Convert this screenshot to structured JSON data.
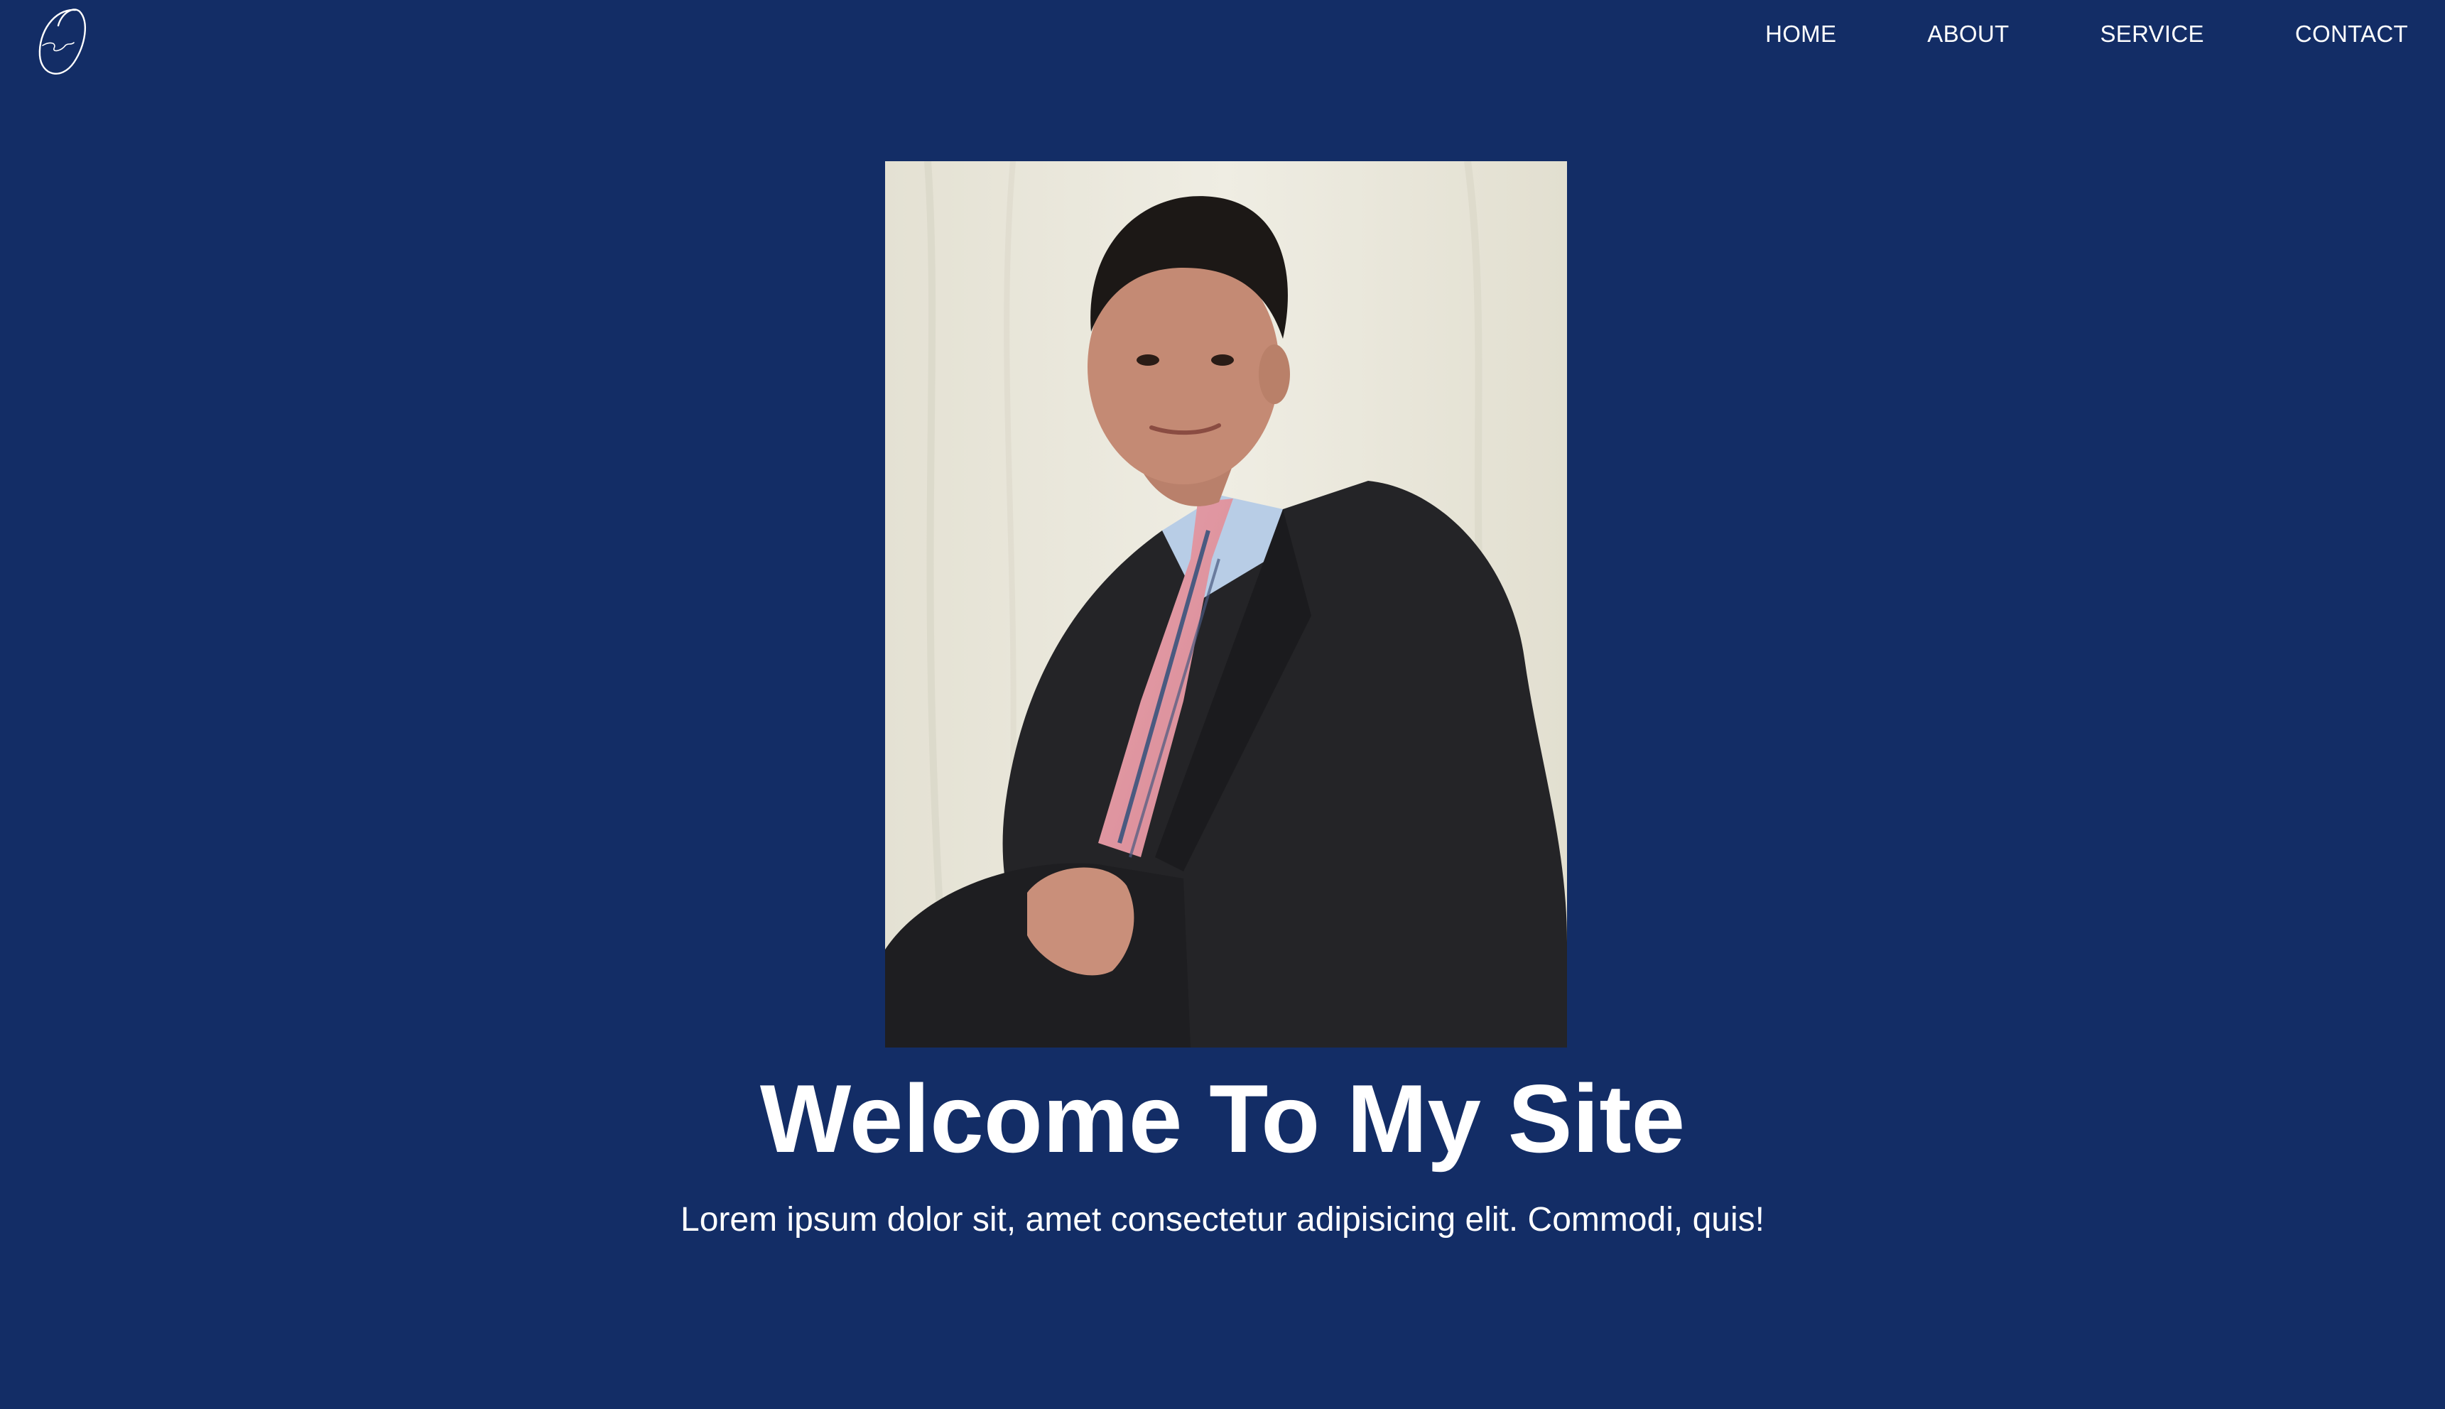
{
  "header": {
    "logo_icon": "signature-logo-icon",
    "nav": {
      "home": "HOME",
      "about": "ABOUT",
      "service": "SERVICE",
      "contact": "CONTACT"
    }
  },
  "hero": {
    "photo_icon": "portrait-photo",
    "title": "Welcome To My Site",
    "subtitle": "Lorem ipsum dolor sit, amet consectetur adipisicing elit. Commodi, quis!"
  },
  "colors": {
    "background": "#132d66",
    "text": "#ffffff"
  }
}
